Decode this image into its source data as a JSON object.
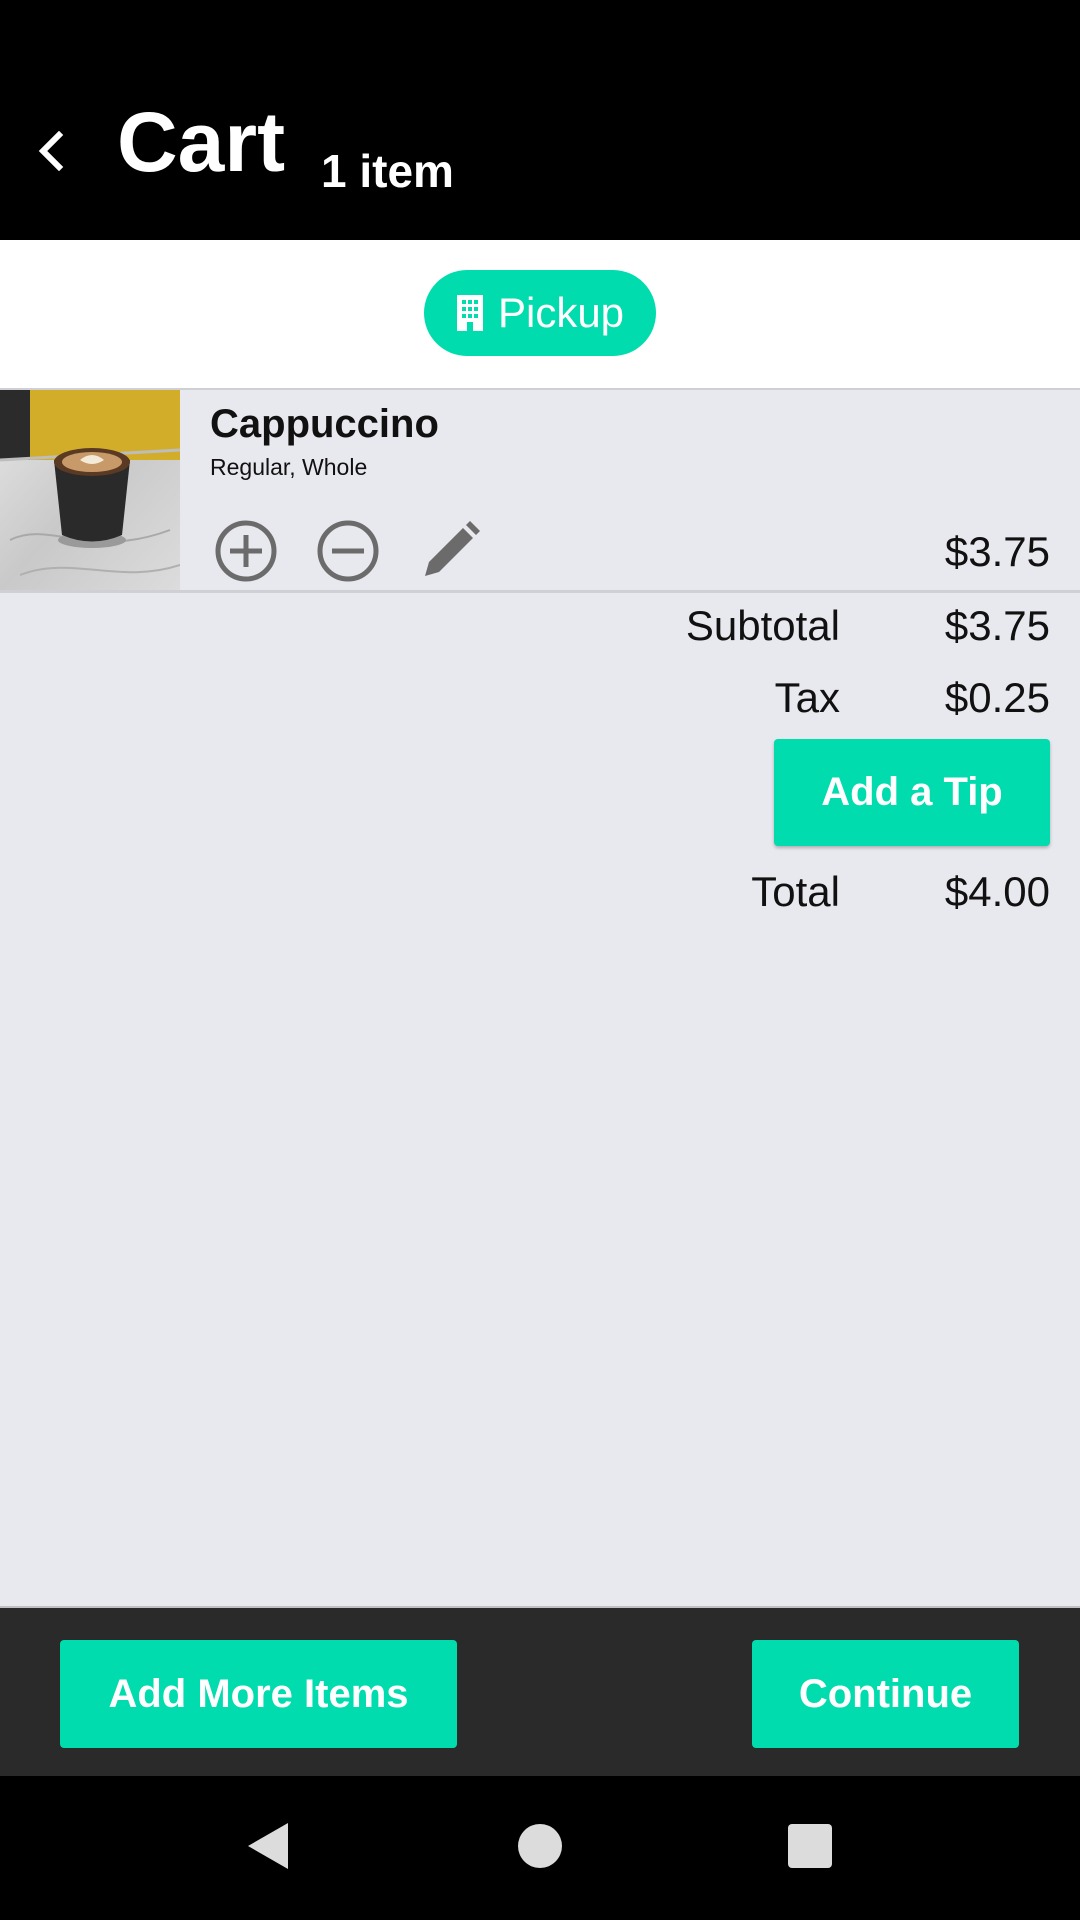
{
  "header": {
    "title": "Cart",
    "item_count": "1 item"
  },
  "order_mode": {
    "label": "Pickup",
    "icon": "building-icon"
  },
  "cart_items": [
    {
      "name": "Cappuccino",
      "options": "Regular, Whole",
      "price": "$3.75",
      "image": "cappuccino-photo"
    }
  ],
  "summary": {
    "subtotal_label": "Subtotal",
    "subtotal_value": "$3.75",
    "tax_label": "Tax",
    "tax_value": "$0.25",
    "tip_button": "Add a Tip",
    "total_label": "Total",
    "total_value": "$4.00"
  },
  "footer": {
    "add_more_label": "Add More Items",
    "continue_label": "Continue"
  },
  "colors": {
    "accent": "#00dcae",
    "header_bg": "#000000",
    "page_bg": "#e8e8ef",
    "footer_bg": "#2a2a2a"
  }
}
